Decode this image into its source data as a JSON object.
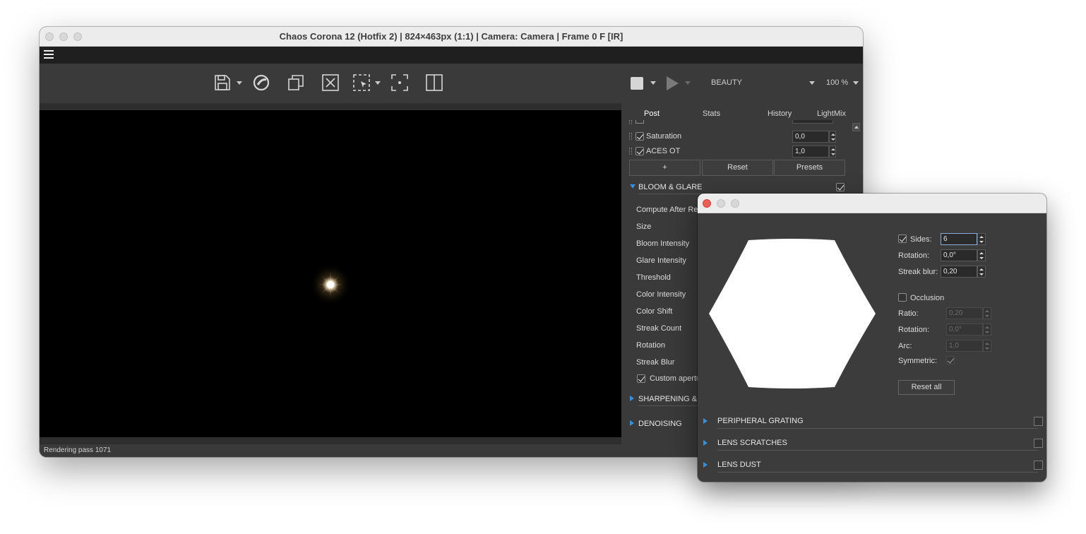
{
  "main_window": {
    "title": "Chaos Corona 12 (Hotfix 2) | 824×463px (1:1) | Camera: Camera | Frame 0 F [IR]",
    "toolbar": {
      "channel": "BEAUTY",
      "zoom": "100 %"
    },
    "status": "Rendering pass 1071"
  },
  "panel": {
    "tabs": [
      "Post",
      "Stats",
      "History",
      "LightMix"
    ],
    "active_tab": "Post",
    "rows": [
      {
        "label": "Saturation",
        "value": "0,0",
        "checked": true
      },
      {
        "label": "ACES OT",
        "value": "1,0",
        "checked": true
      }
    ],
    "buttons": {
      "add": "+",
      "reset": "Reset",
      "presets": "Presets"
    },
    "bloom_section": "BLOOM & GLARE",
    "bloom_items": [
      "Compute After Re",
      "Size",
      "Bloom Intensity",
      "Glare Intensity",
      "Threshold",
      "Color Intensity",
      "Color Shift",
      "Streak Count",
      "Rotation",
      "Streak Blur"
    ],
    "custom_aperture": "Custom apertu",
    "sharpening_section": "SHARPENING & B",
    "denoising_section": "DENOISING"
  },
  "aperture_dialog": {
    "sides_label": "Sides:",
    "sides_value": "6",
    "rotation_label": "Rotation:",
    "rotation_value": "0,0°",
    "streak_blur_label": "Streak blur:",
    "streak_blur_value": "0,20",
    "occlusion_label": "Occlusion",
    "ratio_label": "Ratio:",
    "ratio_value": "0,20",
    "occ_rotation_label": "Rotation:",
    "occ_rotation_value": "0,0°",
    "arc_label": "Arc:",
    "arc_value": "1,0",
    "symmetric_label": "Symmetric:",
    "reset_all": "Reset all",
    "sections": [
      "PERIPHERAL GRATING",
      "LENS SCRATCHES",
      "LENS DUST"
    ]
  },
  "colors": {
    "accent_triangle": "#3b8fd9",
    "close_red": "#ec5f57"
  }
}
